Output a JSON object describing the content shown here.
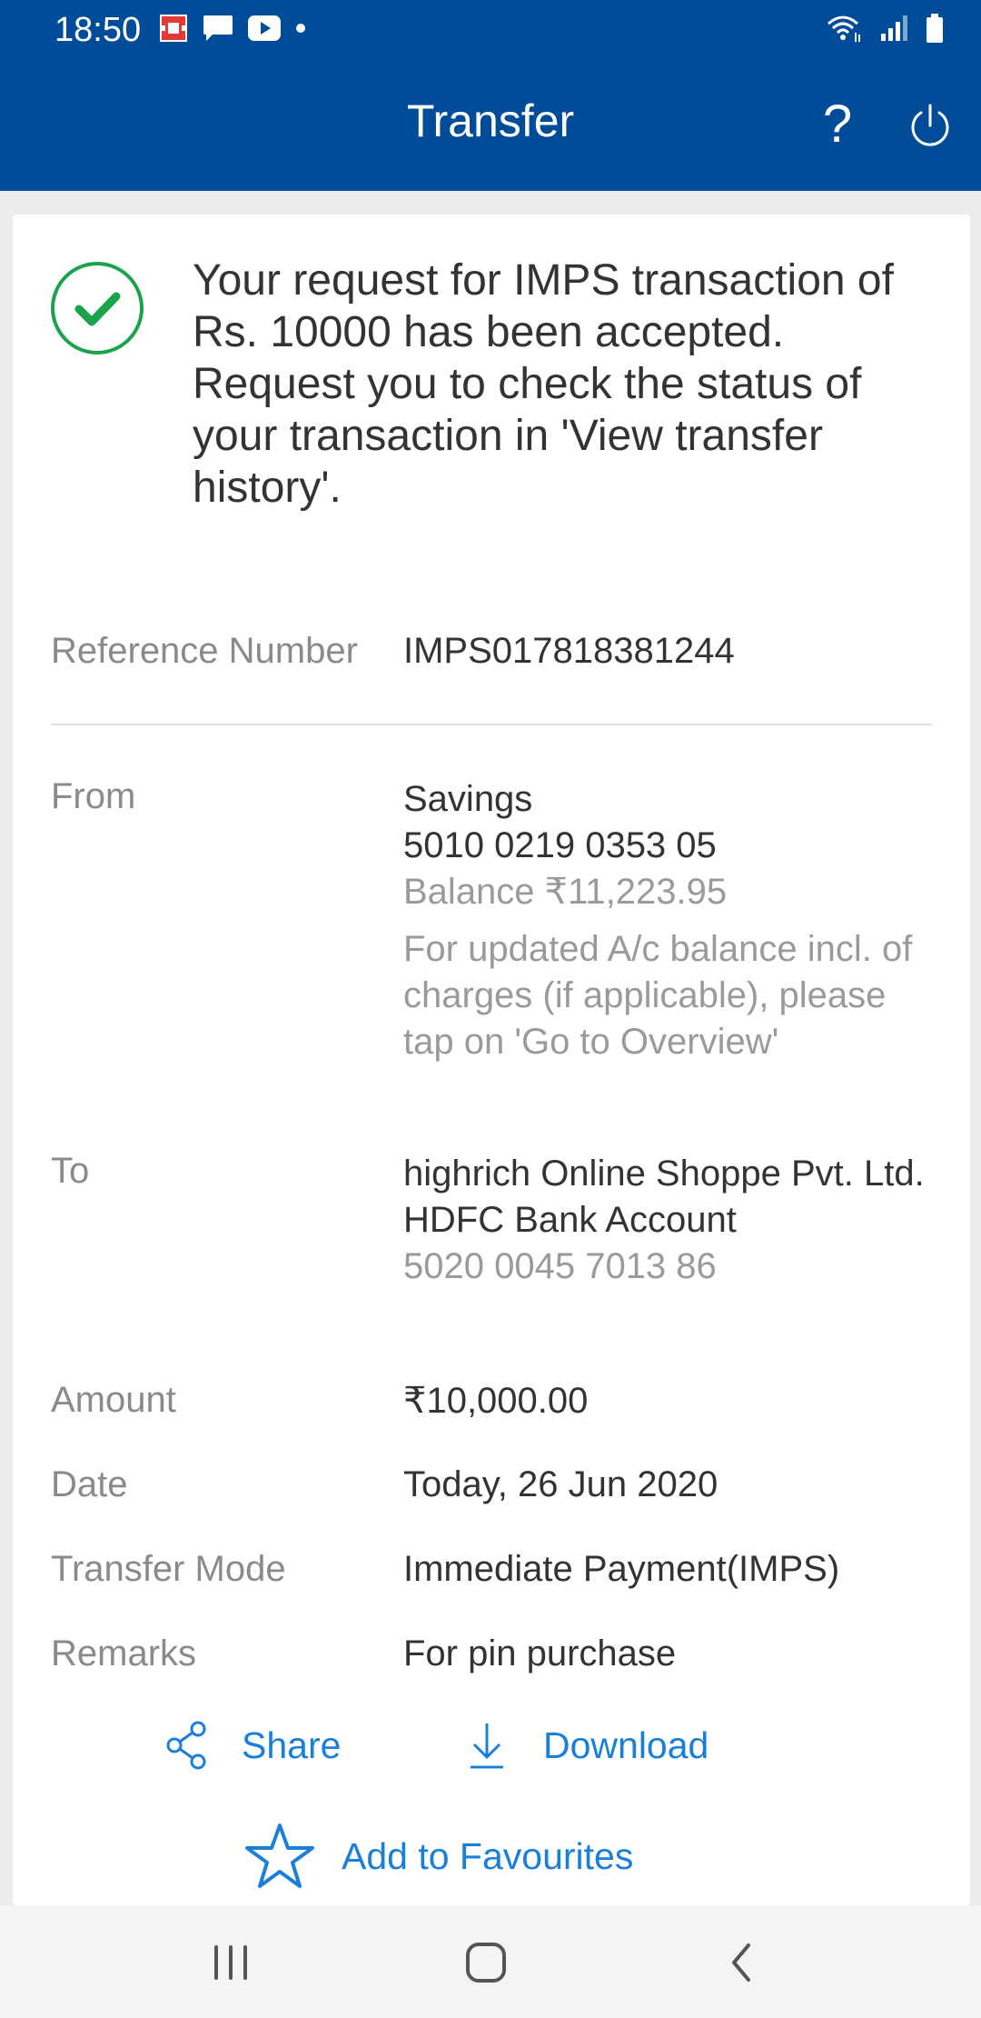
{
  "status_bar": {
    "time": "18:50"
  },
  "app_bar": {
    "title": "Transfer",
    "help_label": "?"
  },
  "message": "Your request for IMPS transaction of Rs. 10000 has been accepted. Request you to check the status of your transaction in 'View transfer history'.",
  "reference": {
    "label": "Reference Number",
    "value": "IMPS017818381244"
  },
  "from": {
    "label": "From",
    "account_type": "Savings",
    "account_number": "5010 0219 0353 05",
    "balance": "Balance ₹11,223.95",
    "note": "For updated A/c balance incl. of charges (if applicable), please tap on 'Go to Overview'"
  },
  "to": {
    "label": "To",
    "name": "highrich Online Shoppe Pvt. Ltd.",
    "bank": "HDFC Bank Account",
    "account_number": "5020 0045 7013 86"
  },
  "amount": {
    "label": "Amount",
    "value": "₹10,000.00"
  },
  "date": {
    "label": "Date",
    "value": "Today, 26 Jun 2020"
  },
  "mode": {
    "label": "Transfer Mode",
    "value": "Immediate Payment(IMPS)"
  },
  "remarks": {
    "label": "Remarks",
    "value": "For pin purchase"
  },
  "actions": {
    "share": "Share",
    "download": "Download",
    "favourites": "Add to Favourites"
  },
  "colors": {
    "brand": "#004c99",
    "link": "#1a7fdb",
    "success": "#1aa34a"
  },
  "icons": [
    "share-icon",
    "download-icon",
    "star-icon",
    "check-circle-icon",
    "power-icon"
  ]
}
